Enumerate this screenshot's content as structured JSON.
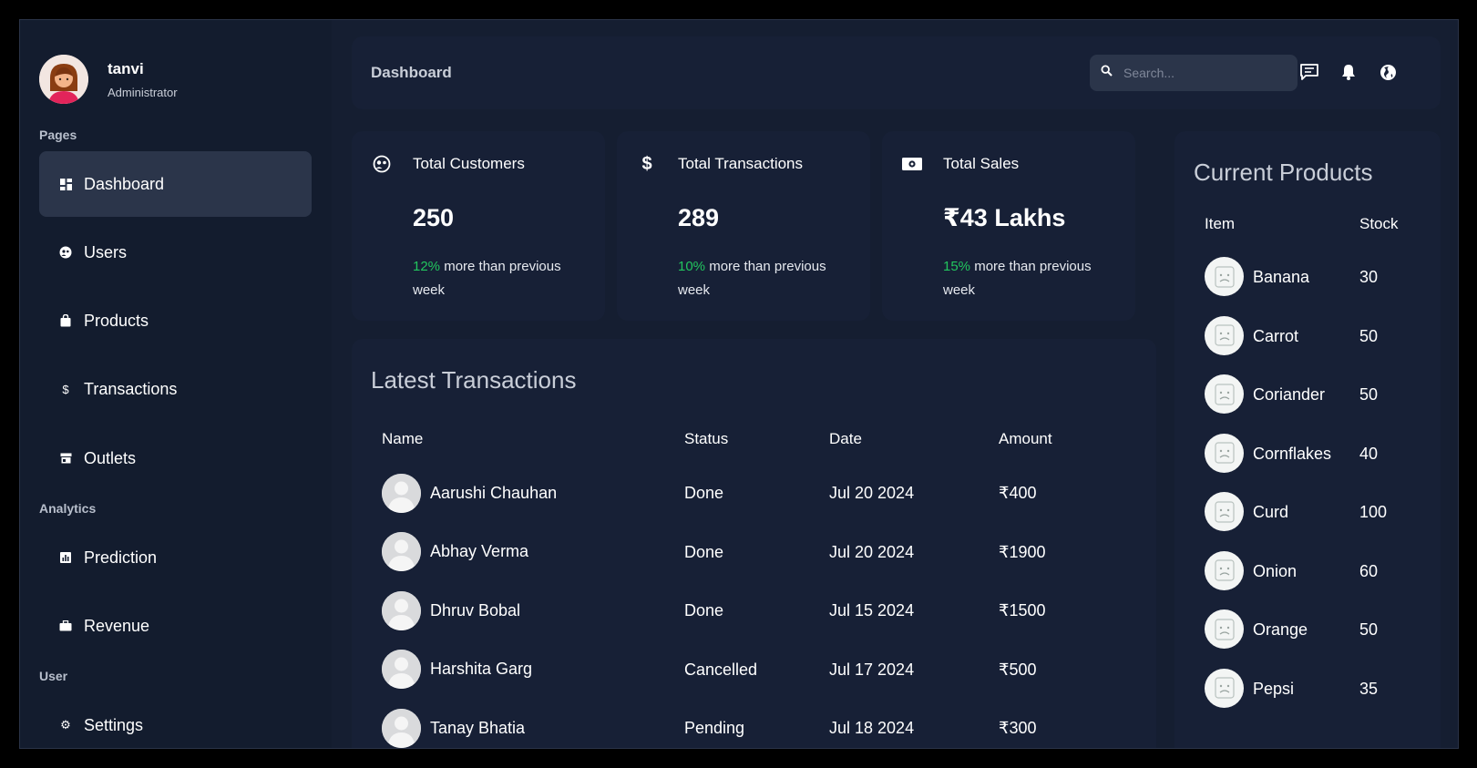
{
  "profile": {
    "name": "tanvi",
    "role": "Administrator"
  },
  "sidebar": {
    "sections": {
      "pages": "Pages",
      "analytics": "Analytics",
      "user": "User"
    },
    "items": [
      {
        "label": "Dashboard",
        "icon": "dashboard-icon",
        "active": true
      },
      {
        "label": "Users",
        "icon": "users-icon"
      },
      {
        "label": "Products",
        "icon": "products-icon"
      },
      {
        "label": "Transactions",
        "icon": "dollar-icon"
      },
      {
        "label": "Outlets",
        "icon": "store-icon"
      },
      {
        "label": "Prediction",
        "icon": "chart-icon"
      },
      {
        "label": "Revenue",
        "icon": "briefcase-icon"
      },
      {
        "label": "Settings",
        "icon": "gear-icon"
      }
    ]
  },
  "header": {
    "title": "Dashboard",
    "search_placeholder": "Search..."
  },
  "stats": [
    {
      "title": "Total Customers",
      "value": "250",
      "pct": "12%",
      "note": " more than previous week"
    },
    {
      "title": "Total Transactions",
      "value": "289",
      "pct": "10%",
      "note": " more than previous week"
    },
    {
      "title": "Total Sales",
      "value": "₹43 Lakhs",
      "pct": "15%",
      "note": " more than previous week"
    }
  ],
  "transactions": {
    "title": "Latest Transactions",
    "columns": [
      "Name",
      "Status",
      "Date",
      "Amount"
    ],
    "rows": [
      {
        "name": "Aarushi Chauhan",
        "status": "Done",
        "date": "Jul 20 2024",
        "amount": "₹400"
      },
      {
        "name": "Abhay Verma",
        "status": "Done",
        "date": "Jul 20 2024",
        "amount": "₹1900"
      },
      {
        "name": "Dhruv Bobal",
        "status": "Done",
        "date": "Jul 15 2024",
        "amount": "₹1500"
      },
      {
        "name": "Harshita Garg",
        "status": "Cancelled",
        "date": "Jul 17 2024",
        "amount": "₹500"
      },
      {
        "name": "Tanay Bhatia",
        "status": "Pending",
        "date": "Jul 18 2024",
        "amount": "₹300"
      }
    ]
  },
  "products": {
    "title": "Current Products",
    "columns": [
      "Item",
      "Stock"
    ],
    "rows": [
      {
        "item": "Banana",
        "stock": "30"
      },
      {
        "item": "Carrot",
        "stock": "50"
      },
      {
        "item": "Coriander",
        "stock": "50"
      },
      {
        "item": "Cornflakes",
        "stock": "40"
      },
      {
        "item": "Curd",
        "stock": "100"
      },
      {
        "item": "Onion",
        "stock": "60"
      },
      {
        "item": "Orange",
        "stock": "50"
      },
      {
        "item": "Pepsi",
        "stock": "35"
      }
    ]
  },
  "colors": {
    "accent_green": "#22c55e",
    "panel": "#172036",
    "background": "#151e31"
  }
}
